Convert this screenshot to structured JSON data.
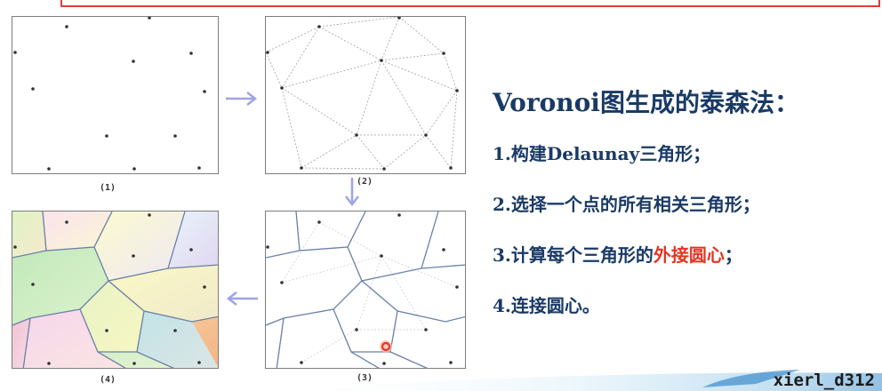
{
  "panels": [
    {
      "id": "p1",
      "caption": "(1)"
    },
    {
      "id": "p2",
      "caption": "(2)"
    },
    {
      "id": "p3",
      "caption": "(3)"
    },
    {
      "id": "p4",
      "caption": "(4)"
    }
  ],
  "title_prefix": "Voronoi",
  "title_suffix": "图生成的泰森法：",
  "steps": {
    "s1": {
      "num": "1.",
      "text": "构建",
      "bold": "Delaunay",
      "end": "三角形；"
    },
    "s2": {
      "num": "2.",
      "text": "选择一个点的所有相关三角形；"
    },
    "s3": {
      "num": "3.",
      "text": "计算每个三角形的",
      "red": "外接圆心",
      "end": "；"
    },
    "s4": {
      "num": "4.",
      "text": "连接圆心。"
    }
  },
  "watermark": "xierl_d312",
  "colors": {
    "text": "#1a3a66",
    "highlight": "#e53421",
    "arrow": "#9fa3e8",
    "edge": "#6a7fa8",
    "frame": "#d9413a"
  }
}
